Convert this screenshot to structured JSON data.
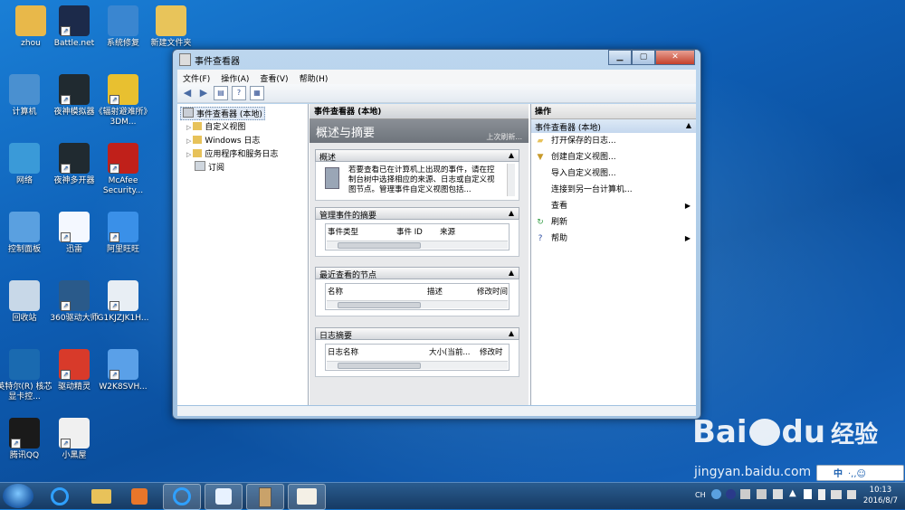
{
  "desktop": {
    "icons": [
      {
        "label": "zhou",
        "color": "#e8b84a"
      },
      {
        "label": "Battle.net",
        "color": "#1c2a4a"
      },
      {
        "label": "系统修复",
        "color": "#3a86d0"
      },
      {
        "label": "新建文件夹",
        "color": "#e8c45a"
      },
      {
        "label": "计算机",
        "color": "#4a90d0"
      },
      {
        "label": "夜神模拟器",
        "color": "#202a30"
      },
      {
        "label": "《辐射避难所》3DM...",
        "color": "#e8c030"
      },
      {
        "label": "网络",
        "color": "#3a9ad8"
      },
      {
        "label": "夜神多开器",
        "color": "#202a30"
      },
      {
        "label": "McAfee Security...",
        "color": "#c0201a"
      },
      {
        "label": "控制面板",
        "color": "#5aa0e0"
      },
      {
        "label": "迅雷",
        "color": "#f4f8ff"
      },
      {
        "label": "阿里旺旺",
        "color": "#3a90e8"
      },
      {
        "label": "回收站",
        "color": "#c8d8e8"
      },
      {
        "label": "360驱动大师",
        "color": "#2a5a8a"
      },
      {
        "label": "G1KJZJK1H...",
        "color": "#e8eef4"
      },
      {
        "label": "英特尔(R) 核芯显卡控...",
        "color": "#1a6ab0"
      },
      {
        "label": "驱动精灵",
        "color": "#d83a2a"
      },
      {
        "label": "W2K8SVH...",
        "color": "#5aa0e8"
      },
      {
        "label": "腾讯QQ",
        "color": "#1a1a1a"
      },
      {
        "label": "小黑屋",
        "color": "#f0f0f0"
      }
    ]
  },
  "window": {
    "title": "事件查看器",
    "controls": {
      "minimize": "▁",
      "maximize": "▢",
      "close": "✕"
    },
    "menu": [
      "文件(F)",
      "操作(A)",
      "查看(V)",
      "帮助(H)"
    ],
    "toolbar": {
      "back": "◀",
      "forward": "▶",
      "show": "▤",
      "help": "?",
      "props": "▦"
    },
    "tree": {
      "root": "事件查看器 (本地)",
      "children": [
        "自定义视图",
        "Windows 日志",
        "应用程序和服务日志",
        "订阅"
      ]
    },
    "middle": {
      "header": "事件查看器 (本地)",
      "banner_title": "概述与摘要",
      "banner_sub": "上次刷新...",
      "sections": [
        {
          "title": "概述",
          "text": "若要查看已在计算机上出现的事件，请在控制台树中选择相应的来源、日志或自定义视图节点。管理事件自定义视图包括..."
        },
        {
          "title": "管理事件的摘要",
          "columns": [
            "事件类型",
            "事件 ID",
            "来源"
          ]
        },
        {
          "title": "最近查看的节点",
          "columns": [
            "名称",
            "描述",
            "修改时间"
          ]
        },
        {
          "title": "日志摘要",
          "columns": [
            "日志名称",
            "大小(当前...",
            "修改时"
          ]
        }
      ]
    },
    "actions": {
      "header": "操作",
      "group": "事件查看器 (本地)",
      "items": [
        {
          "label": "打开保存的日志...",
          "icon": "folder-icon",
          "arrow": ""
        },
        {
          "label": "创建自定义视图...",
          "icon": "filter-icon",
          "arrow": ""
        },
        {
          "label": "导入自定义视图...",
          "icon": "",
          "arrow": ""
        },
        {
          "label": "连接到另一台计算机...",
          "icon": "",
          "arrow": ""
        },
        {
          "label": "查看",
          "icon": "",
          "arrow": "▶"
        },
        {
          "label": "刷新",
          "icon": "refresh-icon",
          "arrow": ""
        },
        {
          "label": "帮助",
          "icon": "help-icon",
          "arrow": "▶"
        }
      ]
    }
  },
  "watermark": {
    "brand": "Bai",
    "brand2": "du",
    "jingyan": "经验",
    "url": "jingyan.baidu.com"
  },
  "ime": {
    "label": "中",
    "symbols": "·,,☺"
  },
  "taskbar": {
    "tray_lang": "CH",
    "time": "10:13",
    "date": "2016/8/7"
  }
}
